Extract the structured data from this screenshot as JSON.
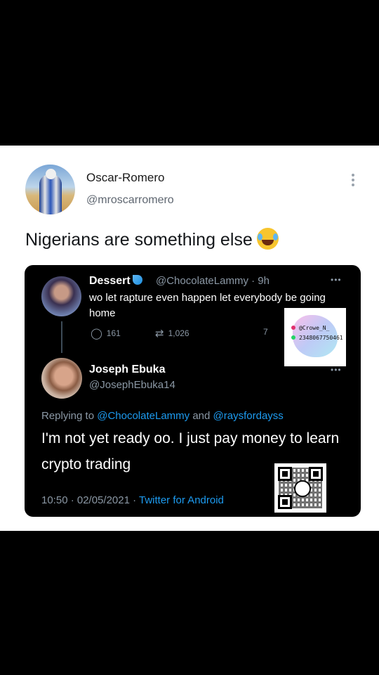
{
  "tweet": {
    "author_name": "Oscar-Romero",
    "author_handle": "@mroscarromero",
    "text": "Nigerians are something else",
    "emoji_icon": "face-with-tears-of-joy-icon"
  },
  "quoted_original": {
    "name": "Dessert",
    "handle_time": "@ChocolateLammy · 9h",
    "text": "wo let rapture even happen let everybody be going home",
    "replies": "161",
    "retweets": "1,026",
    "extra": "7"
  },
  "quoted_reply": {
    "name": "Joseph Ebuka",
    "handle": "@JosephEbuka14",
    "replying_label": "Replying to ",
    "mention_1": "@ChocolateLammy",
    "and_label": " and ",
    "mention_2": "@raysfordayss",
    "text": "I'm not yet ready oo. I just pay money to learn crypto trading",
    "timestamp": "10:50 · 02/05/2021 · ",
    "source": "Twitter for Android"
  },
  "watermark": {
    "instagram": "@Crowe_N_",
    "whatsapp": "2348067750461"
  },
  "colors": {
    "link": "#1d9bf0",
    "muted": "#8b98a5",
    "card_bg": "#ffffff",
    "embed_bg": "#000000"
  }
}
